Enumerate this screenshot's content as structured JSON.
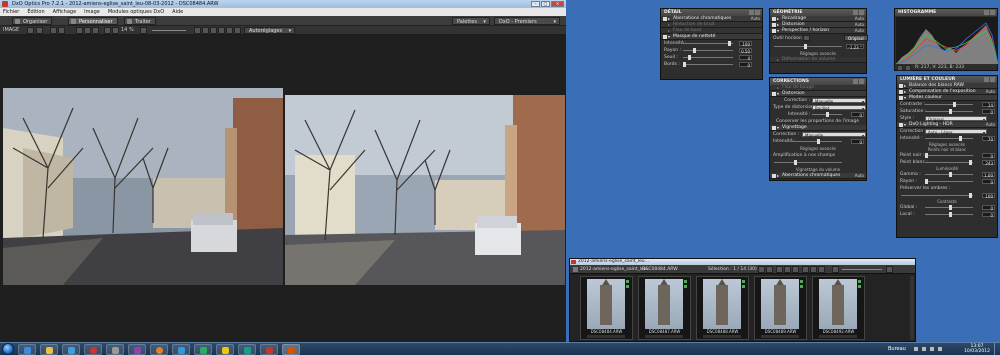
{
  "app": {
    "title": "DxO Optics Pro 7.2.1 - 2012-amiens-eglise_saint_leu-08-03-2012 - DSC08484.ARW",
    "window_buttons": [
      "–",
      "□",
      "✕"
    ],
    "menu": [
      "Fichier",
      "Édition",
      "Affichage",
      "Image",
      "Modules optiques DxO",
      "Aide"
    ],
    "modes": [
      "Organiser",
      "Personnaliser",
      "Traiter"
    ],
    "palettes_btn": "Palettes",
    "preset_btn": "DxO - Premiers pas",
    "toolbar_label": "IMAGE",
    "zoom": "14 %",
    "compare_btn": "Autoréglages"
  },
  "palettes": {
    "detail": {
      "title": "DÉTAIL",
      "sections": [
        {
          "label": "Aberrations chromatiques",
          "auto": "Auto",
          "dim": false
        },
        {
          "label": "Réduction de bruit",
          "auto": "",
          "dim": true
        },
        {
          "label": "Flou de bord",
          "auto": "",
          "dim": true
        },
        {
          "label": "Masque de netteté",
          "auto": "",
          "dim": false
        }
      ],
      "rows": [
        {
          "label": "Intensité :",
          "value": "100"
        },
        {
          "label": "Rayon :",
          "value": "0.50"
        },
        {
          "label": "Seuil :",
          "value": "4"
        },
        {
          "label": "Bords :",
          "value": "0"
        }
      ]
    },
    "geometrie": {
      "title": "GÉOMÉTRIE",
      "sections": [
        {
          "label": "Recadrage",
          "auto": "Auto"
        },
        {
          "label": "Distorsion",
          "auto": "Auto"
        },
        {
          "label": "Perspective / horizon",
          "auto": "Auto"
        }
      ],
      "horizon_label": "Outil horizon :",
      "horizon_btn": "Original",
      "horizon_value": "-1.23 °",
      "advanced": "Réglages avancés",
      "sub_section": "Déformation de volume"
    },
    "corrections": {
      "title": "CORRECTIONS",
      "sections_top": [
        {
          "label": "Flou de bougé",
          "dim": true
        },
        {
          "label": "Distorsion",
          "dim": false
        }
      ],
      "correction_label": "Correction :",
      "correction_value": "Manuelle",
      "type_label": "Type de distorsion :",
      "type_value": "Barillet",
      "intensity_label": "Intensité :",
      "intensity_value": "0",
      "keep_proportions": "Conserver les proportions de l'image",
      "vignettage": "Vignettage",
      "vig_correction_label": "Correction :",
      "vig_correction_value": "Manuelle",
      "vig_intensity_label": "Intensité :",
      "vig_intensity_value": "0",
      "vig_advanced": "Réglages avancés",
      "vig_amp": "Amplification à nos champs",
      "vig_sub": "Vignettage du volume",
      "aberrations": "Aberrations chromatiques",
      "aberrations_auto": "Auto"
    },
    "histogram": {
      "title": "HISTOGRAMME",
      "readout": "R: 217, V: 223, B: 233"
    },
    "lumiere": {
      "title": "LUMIÈRE ET COULEUR",
      "sections": [
        {
          "label": "Balance des blancs RAW"
        },
        {
          "label": "Compensation de l'exposition",
          "auto": "Auto"
        },
        {
          "label": "Modes couleur"
        }
      ],
      "contrast_label": "Contraste :",
      "contrast_value": "14",
      "saturation_label": "Saturation :",
      "saturation_value": "0",
      "style_label": "Style :",
      "style_value": "Original",
      "lighting": "DxO Lighting - HDR",
      "lighting_auto": "Auto",
      "corr_label": "Correction :",
      "corr_value": "Auto - Léger",
      "int_label": "Intensité :",
      "int_value": "70",
      "advanced": "Réglages avancés",
      "advanced_sub": "Points noir et blanc",
      "point_noir_label": "Point noir :",
      "point_noir_value": "0",
      "point_blanc_label": "Point blanc :",
      "point_blanc_value": "243",
      "luminosite": "Luminosité",
      "gamma_label": "Gamma :",
      "gamma_value": "1.00",
      "rayon_label": "Rayon :",
      "rayon_value": "0",
      "preserver_label": "Préserver les ombres :",
      "preserver_value": "100",
      "contraste_sub": "Contraste",
      "global_label": "Global :",
      "global_value": "0",
      "local_label": "Local :",
      "local_value": "0"
    }
  },
  "browser": {
    "title": "2012-amiens-eglise_saint_leu...",
    "crumb_folder": "2012-amiens-eglise_saint_leu...",
    "crumb_file": "DSC08484.ARW",
    "selection": "Sélection : 1 / 14 (30)",
    "thumbs": [
      "DSC08484.ARW",
      "DSC08487.ARW",
      "DSC08488.ARW",
      "DSC08489.ARW",
      "DSC08492.ARW"
    ]
  },
  "taskbar": {
    "lang": "Bureau",
    "time": "13:07",
    "date": "10/03/2012"
  },
  "colors": {
    "desktop": "#3a6fb8",
    "panel": "#2e2e2e",
    "accent_green": "#4caf50"
  }
}
